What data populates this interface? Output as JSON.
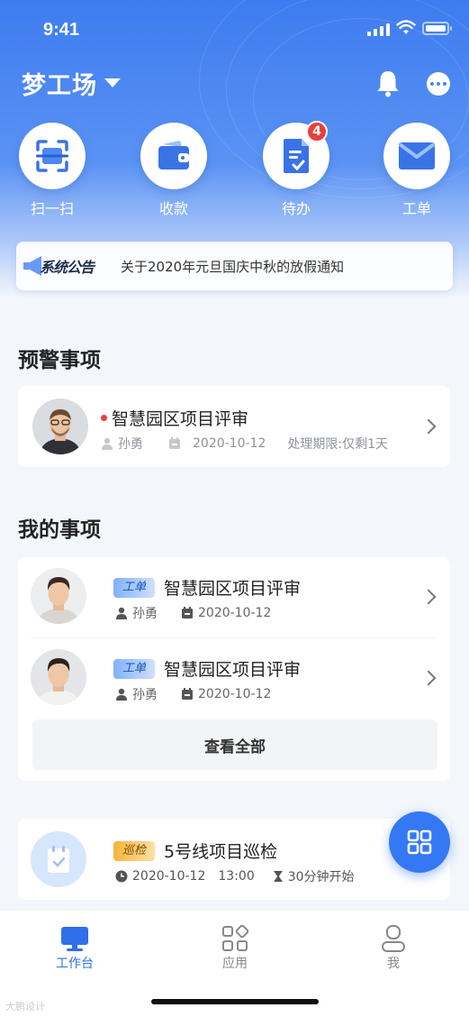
{
  "status_bar": {
    "time": "9:41"
  },
  "header": {
    "title": "梦工场"
  },
  "quick_actions": [
    {
      "label": "扫一扫",
      "icon": "scan-icon"
    },
    {
      "label": "收款",
      "icon": "wallet-icon"
    },
    {
      "label": "待办",
      "icon": "todo-document-icon",
      "badge": "4"
    },
    {
      "label": "工单",
      "icon": "mail-icon"
    }
  ],
  "notice": {
    "tag": "系统公告",
    "text": "关于2020年元旦国庆中秋的放假通知"
  },
  "alerts": {
    "title": "预警事项",
    "item": {
      "title": "智慧园区项目评审",
      "person": "孙勇",
      "date": "2020-10-12",
      "deadline": "处理期限:仅剩1天"
    }
  },
  "my_items": {
    "title": "我的事项",
    "items": [
      {
        "tag": "工单",
        "title": "智慧园区项目评审",
        "person": "孙勇",
        "date": "2020-10-12"
      },
      {
        "tag": "工单",
        "title": "智慧园区项目评审",
        "person": "孙勇",
        "date": "2020-10-12"
      }
    ],
    "view_all": "查看全部"
  },
  "inspection": {
    "tag": "巡检",
    "title": "5号线项目巡检",
    "date": "2020-10-12",
    "time": "13:00",
    "countdown": "30分钟开始"
  },
  "tabbar": [
    {
      "label": "工作台",
      "active": true
    },
    {
      "label": "应用"
    },
    {
      "label": "我"
    }
  ],
  "watermark": "大鹏设计",
  "colors": {
    "primary": "#3478f6",
    "alert_red": "#e8403c",
    "tag_blue": "#7fb2fb",
    "tag_orange": "#f6b53a"
  }
}
